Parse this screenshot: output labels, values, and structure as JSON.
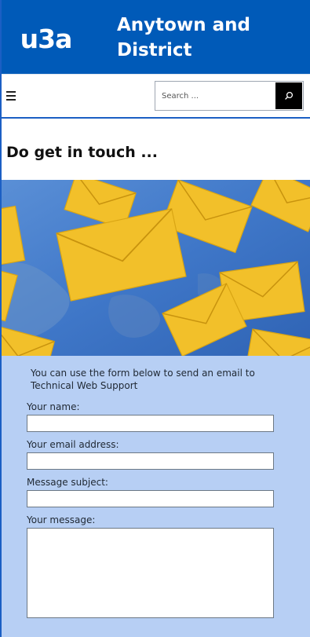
{
  "header": {
    "logo_text": "u3a",
    "title_line1": "Anytown and",
    "title_line2": "District"
  },
  "toolbar": {
    "menu_icon": "hamburger-menu-icon",
    "search_placeholder": "Search ...",
    "search_icon": "search-icon"
  },
  "page": {
    "title": "Do get in touch ..."
  },
  "hero": {
    "image": "flying-envelopes-illustration"
  },
  "form": {
    "intro": "You can use the form below to send an email to Technical Web Support",
    "name_label": "Your name:",
    "name_value": "",
    "email_label": "Your email address:",
    "email_value": "",
    "subject_label": "Message subject:",
    "subject_value": "",
    "message_label": "Your message:",
    "message_value": ""
  },
  "colors": {
    "brand_blue": "#005ab8",
    "form_bg": "#b7cff4",
    "envelope_yellow": "#f2c02a",
    "hero_bg": "#3d74c6"
  }
}
